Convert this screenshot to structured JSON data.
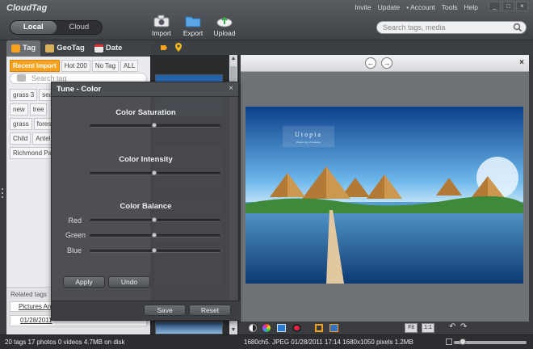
{
  "app": {
    "logo": "CloudTag"
  },
  "top": {
    "seg": [
      "Local",
      "Cloud"
    ],
    "toolbar": [
      {
        "label": "Import",
        "icon": "camera-icon"
      },
      {
        "label": "Export",
        "icon": "folder-icon"
      },
      {
        "label": "Upload",
        "icon": "cloud-upload-icon"
      }
    ],
    "menu": [
      "Invite",
      "Update",
      "Account",
      "Tools",
      "Help"
    ],
    "window": [
      "_",
      "□",
      "×"
    ],
    "search_placeholder": "Search tags, media"
  },
  "left": {
    "tabs": [
      "Tag",
      "GeoTag",
      "Date"
    ],
    "filters": [
      "Recent Import",
      "Hot 200",
      "No Tag",
      "ALL"
    ],
    "tag_search_placeholder": "Search tag",
    "tags": [
      "grass 3",
      "sea",
      "new",
      "tree",
      "grass",
      "fores",
      "Child",
      "Antel",
      "Richmond Pa"
    ],
    "related_title": "Related tags",
    "related_crumb": "Pictures  An",
    "related_date": "01/28/2011"
  },
  "tune": {
    "title": "Tune - Color",
    "close": "×",
    "sections": [
      "Color Saturation",
      "Color Intensity",
      "Color Balance"
    ],
    "balance_labels": [
      "Red",
      "Green",
      "Blue"
    ],
    "apply": "Apply",
    "undo": "Undo",
    "save": "Save",
    "reset": "Reset",
    "levels": {
      "saturation": 0.5,
      "intensity": 0.5,
      "red": 0.5,
      "green": 0.5,
      "blue": 0.5
    }
  },
  "viewer": {
    "prev": "←",
    "next": "→",
    "close": "×",
    "photo_title": "Utopia",
    "photo_subtitle": "Dream city of paradise",
    "fit": "Fit",
    "one_to_one": "1:1"
  },
  "status": {
    "left": "20 tags 17 photos 0 videos 4.7MB on disk",
    "right": "1680ch5. JPEG 01/28/2011 17:14 1680x1050 pixels 1.2MB",
    "zoom": 0.08
  },
  "colors": {
    "accent": "#f7a21c",
    "dark": "#3a3c3f"
  }
}
